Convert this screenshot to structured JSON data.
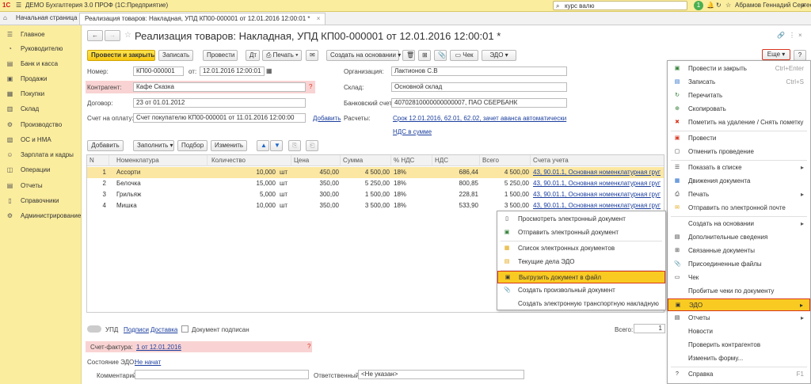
{
  "app": {
    "logo": "1С",
    "title": "ДЕМО Бухгалтерия 3.0 ПРОФ   (1С:Предприятие)",
    "search_value": "курс валю",
    "user": "Абрамов Геннадий Сергеевич",
    "notif_count": "1"
  },
  "tabs": [
    "Начальная страница",
    "Реализация товаров: Накладная, УПД КП00-000001 от 12.01.2016 12:00:01 *"
  ],
  "sidebar": [
    "Главное",
    "Руководителю",
    "Банк и касса",
    "Продажи",
    "Покупки",
    "Склад",
    "Производство",
    "ОС и НМА",
    "Зарплата и кадры",
    "Операции",
    "Отчеты",
    "Справочники",
    "Администрирование"
  ],
  "doc": {
    "title": "Реализация товаров: Накладная, УПД КП00-000001 от 12.01.2016 12:00:01 *",
    "toolbar": {
      "post_close": "Провести и закрыть",
      "save": "Записать",
      "post": "Провести",
      "print": "Печать",
      "create_based": "Создать на основании",
      "check": "Чек",
      "edo": "ЭДО",
      "more": "Еще",
      "help": "?"
    },
    "fields": {
      "number_label": "Номер:",
      "number": "КП00-000001",
      "from_label": "от:",
      "date": "12.01.2016 12:00:01",
      "org_label": "Организация:",
      "org": "Лактионов С.В",
      "counterparty_label": "Контрагент:",
      "counterparty": "Кафе Сказка",
      "warehouse_label": "Склад:",
      "warehouse": "Основной склад",
      "contract_label": "Договор:",
      "contract": "23 от 01.01.2012",
      "bank_label": "Банковский счет:",
      "bank": "40702810000000000007, ПАО СБЕРБАНК",
      "invoice_label": "Счет на оплату:",
      "invoice": "Счет покупателю КП00-000001 от 11.01.2016 12:00:00",
      "add_link": "Добавить",
      "settlements_label": "Расчеты:",
      "settlements_link": "Срок 12.01.2016, 62.01, 62.02, зачет аванса автоматически",
      "vat_link": "НДС в сумме"
    },
    "table_toolbar": {
      "add": "Добавить",
      "fill": "Заполнить",
      "pick": "Подбор",
      "change": "Изменить"
    },
    "columns": [
      "N",
      "Номенклатура",
      "Количество",
      "Цена",
      "Сумма",
      "% НДС",
      "НДС",
      "Всего",
      "Счета учета"
    ],
    "rows": [
      {
        "n": "1",
        "item": "Ассорти",
        "qty": "10,000",
        "unit": "шт",
        "price": "450,00",
        "sum": "4 500,00",
        "vat_rate": "18%",
        "vat": "686,44",
        "total": "4 500,00",
        "account": "43, 90.01.1, Основная номенклатурная групп"
      },
      {
        "n": "2",
        "item": "Белочка",
        "qty": "15,000",
        "unit": "шт",
        "price": "350,00",
        "sum": "5 250,00",
        "vat_rate": "18%",
        "vat": "800,85",
        "total": "5 250,00",
        "account": "43, 90.01.1, Основная номенклатурная групп"
      },
      {
        "n": "3",
        "item": "Грильяж",
        "qty": "5,000",
        "unit": "шт",
        "price": "300,00",
        "sum": "1 500,00",
        "vat_rate": "18%",
        "vat": "228,81",
        "total": "1 500,00",
        "account": "43, 90.01.1, Основная номенклатурная групп"
      },
      {
        "n": "4",
        "item": "Мишка",
        "qty": "10,000",
        "unit": "шт",
        "price": "350,00",
        "sum": "3 500,00",
        "vat_rate": "18%",
        "vat": "533,90",
        "total": "3 500,00",
        "account": "43, 90.01.1, Основная номенклатурная групп"
      }
    ],
    "footer": {
      "upd": "УПД",
      "signatures": "Подписи",
      "delivery": "Доставка",
      "signed": "Документ подписан",
      "total_label": "Всего:",
      "total_value": "1",
      "invoice_label": "Счет-фактура:",
      "invoice_link": "1 от 12.01.2016",
      "edo_state_label": "Состояние ЭДО:",
      "edo_state_link": "Не начат",
      "comment_label": "Комментарий:",
      "responsible_label": "Ответственный:",
      "responsible": "<Не указан>"
    }
  },
  "more_menu": [
    {
      "label": "Провести и закрыть",
      "shortcut": "Ctrl+Enter"
    },
    {
      "label": "Записать",
      "shortcut": "Ctrl+S"
    },
    {
      "label": "Перечитать",
      "shortcut": ""
    },
    {
      "label": "Скопировать",
      "shortcut": ""
    },
    {
      "label": "Пометить на удаление / Снять пометку",
      "shortcut": ""
    },
    {
      "label": "Провести",
      "shortcut": ""
    },
    {
      "label": "Отменить проведение",
      "shortcut": ""
    },
    {
      "label": "Показать в списке",
      "shortcut": ""
    },
    {
      "label": "Движения документа",
      "shortcut": ""
    },
    {
      "label": "Печать",
      "shortcut": ""
    },
    {
      "label": "Отправить по электронной почте",
      "shortcut": ""
    },
    {
      "label": "Создать на основании",
      "shortcut": ""
    },
    {
      "label": "Дополнительные сведения",
      "shortcut": ""
    },
    {
      "label": "Связанные документы",
      "shortcut": ""
    },
    {
      "label": "Присоединенные файлы",
      "shortcut": ""
    },
    {
      "label": "Чек",
      "shortcut": ""
    },
    {
      "label": "Пробитые чеки по документу",
      "shortcut": ""
    },
    {
      "label": "ЭДО",
      "shortcut": ""
    },
    {
      "label": "Отчеты",
      "shortcut": ""
    },
    {
      "label": "Новости",
      "shortcut": ""
    },
    {
      "label": "Проверить контрагентов",
      "shortcut": ""
    },
    {
      "label": "Изменить форму...",
      "shortcut": ""
    },
    {
      "label": "Справка",
      "shortcut": "F1"
    }
  ],
  "edo_menu": [
    "Просмотреть электронный документ",
    "Отправить электронный документ",
    "Список электронных документов",
    "Текущие дела ЭДО",
    "Выгрузить документ в файл",
    "Создать произвольный документ",
    "Создать электронную транспортную накладную"
  ],
  "colors": {
    "accent_yellow": "#f9cb22",
    "sidebar_bg": "#fbed9e",
    "highlight_border": "#d9351e",
    "link": "#1c3f9e"
  }
}
